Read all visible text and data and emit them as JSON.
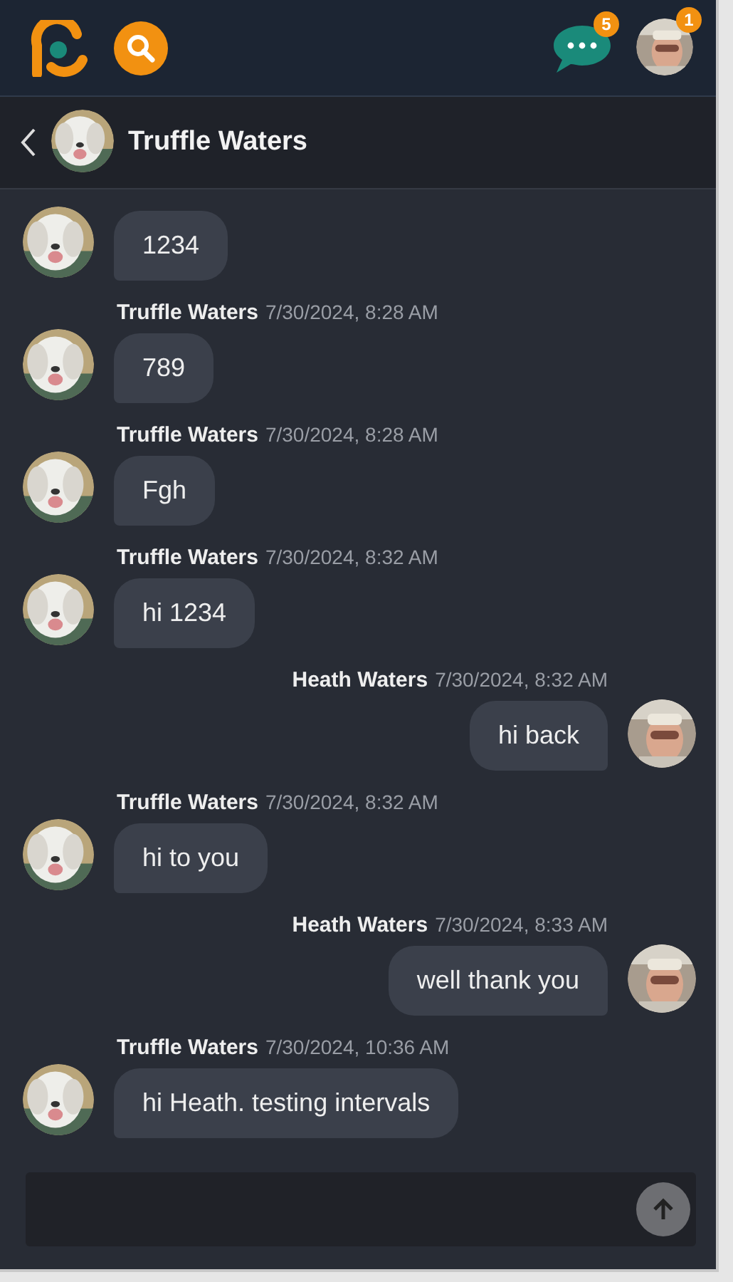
{
  "top_bar": {
    "chat_badge": "5",
    "profile_badge": "1"
  },
  "conversation": {
    "title": "Truffle Waters"
  },
  "messages": [
    {
      "kind": "received",
      "text": "1234"
    },
    {
      "kind": "received",
      "author": "Truffle Waters",
      "time": "7/30/2024, 8:28 AM",
      "text": "789"
    },
    {
      "kind": "received",
      "author": "Truffle Waters",
      "time": "7/30/2024, 8:28 AM",
      "text": "Fgh"
    },
    {
      "kind": "received",
      "author": "Truffle Waters",
      "time": "7/30/2024, 8:32 AM",
      "text": "hi 1234"
    },
    {
      "kind": "sent",
      "author": "Heath Waters",
      "time": "7/30/2024, 8:32 AM",
      "text": "hi back"
    },
    {
      "kind": "received",
      "author": "Truffle Waters",
      "time": "7/30/2024, 8:32 AM",
      "text": "hi to you"
    },
    {
      "kind": "sent",
      "author": "Heath Waters",
      "time": "7/30/2024, 8:33 AM",
      "text": "well thank you"
    },
    {
      "kind": "received",
      "author": "Truffle Waters",
      "time": "7/30/2024, 10:36 AM",
      "text": "hi Heath. testing intervals"
    }
  ]
}
